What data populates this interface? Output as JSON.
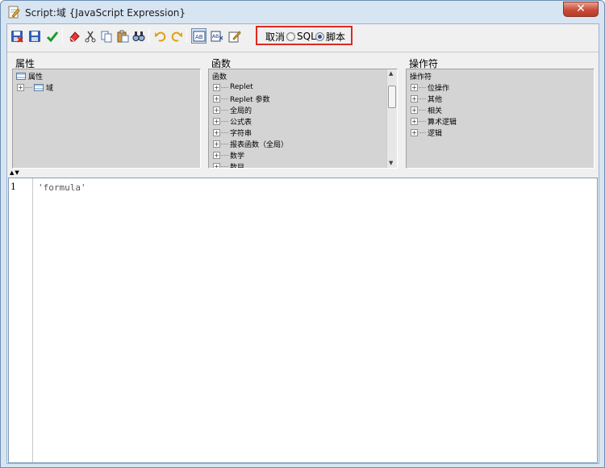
{
  "window": {
    "title": "Script:域 {JavaScript Expression}"
  },
  "mode_group": {
    "cancel_label": "取消",
    "options": [
      {
        "label": "SQL",
        "checked": false
      },
      {
        "label": "脚本",
        "checked": true
      }
    ]
  },
  "panes": {
    "properties": {
      "label": "属性",
      "items": [
        {
          "label": "属性",
          "icon": "table-icon"
        },
        {
          "label": "域",
          "icon": "table-icon"
        }
      ]
    },
    "functions": {
      "label": "函数",
      "root": "函数",
      "items": [
        "Replet",
        "Replet 参数",
        "全局的",
        "公式表",
        "字符串",
        "报表函数（全局）",
        "数学",
        "数目"
      ]
    },
    "operators": {
      "label": "操作符",
      "root": "操作符",
      "items": [
        "位操作",
        "其他",
        "相关",
        "算术逻辑",
        "逻辑"
      ]
    }
  },
  "editor": {
    "line_number": "1",
    "code": "'formula'"
  },
  "colors": {
    "highlight_border": "#e0291f",
    "pane_background": "#d4d4d4"
  }
}
